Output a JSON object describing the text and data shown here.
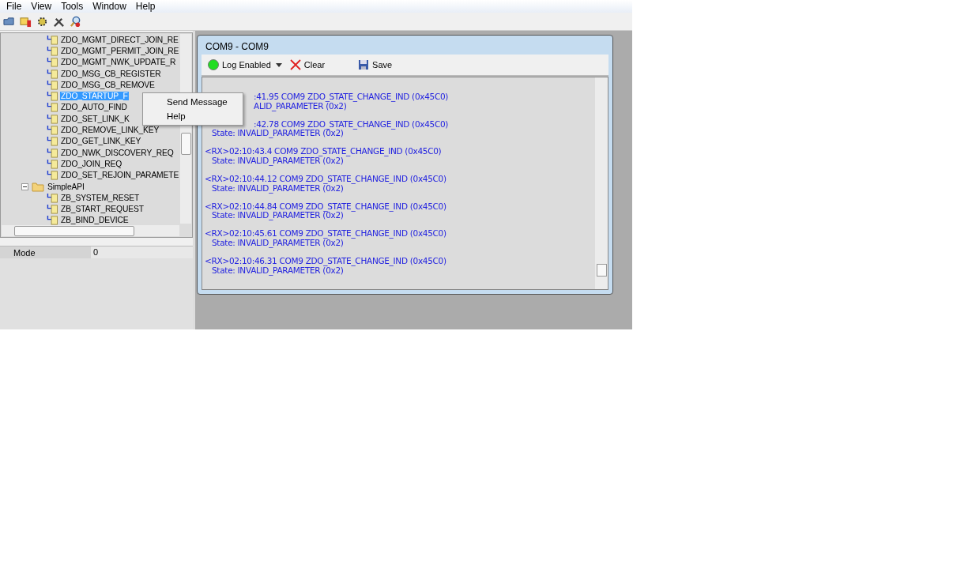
{
  "menu": [
    "File",
    "View",
    "Tools",
    "Window",
    "Help"
  ],
  "tree": [
    {
      "kind": "folder-hidden",
      "children": [
        {
          "kind": "command",
          "label": "ZDO_MGMT_DIRECT_JOIN_RE",
          "selected": false
        },
        {
          "kind": "command",
          "label": "ZDO_MGMT_PERMIT_JOIN_RE",
          "selected": false
        },
        {
          "kind": "command",
          "label": "ZDO_MGMT_NWK_UPDATE_R",
          "selected": false
        },
        {
          "kind": "command",
          "label": "ZDO_MSG_CB_REGISTER",
          "selected": false
        },
        {
          "kind": "command",
          "label": "ZDO_MSG_CB_REMOVE",
          "selected": false
        },
        {
          "kind": "command",
          "label": "ZDO_STARTUP_F",
          "selected": true
        },
        {
          "kind": "command",
          "label": "ZDO_AUTO_FIND",
          "selected": false
        },
        {
          "kind": "command",
          "label": "ZDO_SET_LINK_K",
          "selected": false
        },
        {
          "kind": "command",
          "label": "ZDO_REMOVE_LINK_KEY",
          "selected": false
        },
        {
          "kind": "command",
          "label": "ZDO_GET_LINK_KEY",
          "selected": false
        },
        {
          "kind": "command",
          "label": "ZDO_NWK_DISCOVERY_REQ",
          "selected": false
        },
        {
          "kind": "command",
          "label": "ZDO_JOIN_REQ",
          "selected": false
        },
        {
          "kind": "command",
          "label": "ZDO_SET_REJOIN_PARAMETE",
          "selected": false
        }
      ]
    },
    {
      "kind": "folder",
      "label": "SimpleAPI",
      "expanded": true,
      "children": [
        {
          "kind": "command",
          "label": "ZB_SYSTEM_RESET",
          "selected": false
        },
        {
          "kind": "command",
          "label": "ZB_START_REQUEST",
          "selected": false
        },
        {
          "kind": "command",
          "label": "ZB_BIND_DEVICE",
          "selected": false
        }
      ]
    }
  ],
  "context_menu": [
    "Send Message",
    "Help"
  ],
  "properties": [
    {
      "name": "Mode",
      "value": "0"
    }
  ],
  "child_window": {
    "title": "COM9 - COM9",
    "toolbar": {
      "log": {
        "label": "Log Enabled",
        "on": true
      },
      "clear": "Clear",
      "save": "Save"
    },
    "log": [
      {
        "kind": "cut",
        "head": ":41.95 COM9 ZDO_STATE_CHANGE_IND (0x45C0)",
        "state": "ALID_PARAMETER (0x2)"
      },
      {
        "kind": "cut",
        "head": ":42.78 COM9 ZDO_STATE_CHANGE_IND (0x45C0)",
        "state": "State: INVALID_PARAMETER (0x2)"
      },
      {
        "kind": "full",
        "head": "<RX>02:10:43.4 COM9 ZDO_STATE_CHANGE_IND (0x45C0)",
        "state": "State: INVALID_PARAMETER (0x2)"
      },
      {
        "kind": "full",
        "head": "<RX>02:10:44.12 COM9 ZDO_STATE_CHANGE_IND (0x45C0)",
        "state": "State: INVALID_PARAMETER (0x2)"
      },
      {
        "kind": "full",
        "head": "<RX>02:10:44.84 COM9 ZDO_STATE_CHANGE_IND (0x45C0)",
        "state": "State: INVALID_PARAMETER (0x2)"
      },
      {
        "kind": "full",
        "head": "<RX>02:10:45.61 COM9 ZDO_STATE_CHANGE_IND (0x45C0)",
        "state": "State: INVALID_PARAMETER (0x2)"
      },
      {
        "kind": "full",
        "head": "<RX>02:10:46.31 COM9 ZDO_STATE_CHANGE_IND (0x45C0)",
        "state": "State: INVALID_PARAMETER (0x2)"
      }
    ]
  }
}
